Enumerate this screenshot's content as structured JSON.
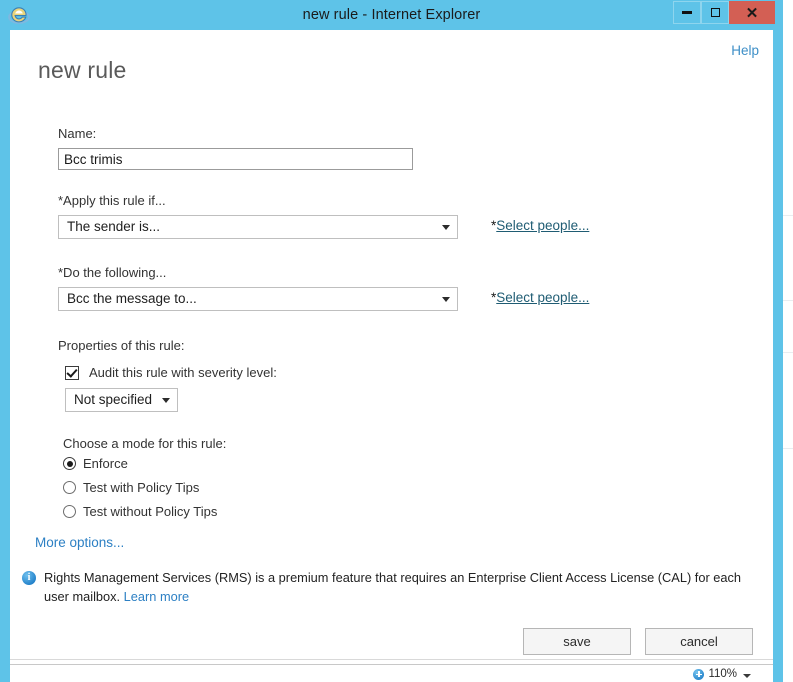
{
  "window": {
    "title": "new rule - Internet Explorer",
    "app_icon": "internet-explorer-icon",
    "minimize_label": "Minimize",
    "maximize_label": "Maximize",
    "close_label": "Close",
    "chrome_color": "#5ec3e8",
    "close_color": "#d35f54"
  },
  "page": {
    "title": "new rule",
    "help_label": "Help"
  },
  "form": {
    "name": {
      "label": "Name:",
      "value": "Bcc trimis",
      "placeholder": ""
    },
    "condition": {
      "label": "*Apply this rule if...",
      "selected": "The sender is...",
      "link_asterisk": "*",
      "link_label": "Select people...",
      "options": [
        "The sender is..."
      ]
    },
    "action": {
      "label": "*Do the following...",
      "selected": "Bcc the message to...",
      "link_asterisk": "*",
      "link_label": "Select people...",
      "options": [
        "Bcc the message to..."
      ]
    },
    "properties": {
      "label": "Properties of this rule:",
      "audit_checkbox_label": "Audit this rule with severity level:",
      "audit_checked": true,
      "severity_selected": "Not specified",
      "severity_options": [
        "Not specified"
      ]
    },
    "mode": {
      "label": "Choose a mode for this rule:",
      "options": [
        {
          "label": "Enforce",
          "selected": true
        },
        {
          "label": "Test with Policy Tips",
          "selected": false
        },
        {
          "label": "Test without Policy Tips",
          "selected": false
        }
      ]
    },
    "more_options_label": "More options..."
  },
  "notice": {
    "icon": "info-icon",
    "text": "Rights Management Services (RMS) is a premium feature that requires an Enterprise Client Access License (CAL) for each user mailbox.",
    "link_label": "Learn more",
    "accent_color": "#2d80c4"
  },
  "actions": {
    "save_label": "save",
    "cancel_label": "cancel"
  },
  "statusbar": {
    "zoom_icon": "zoom-icon",
    "zoom_level": "110%"
  }
}
